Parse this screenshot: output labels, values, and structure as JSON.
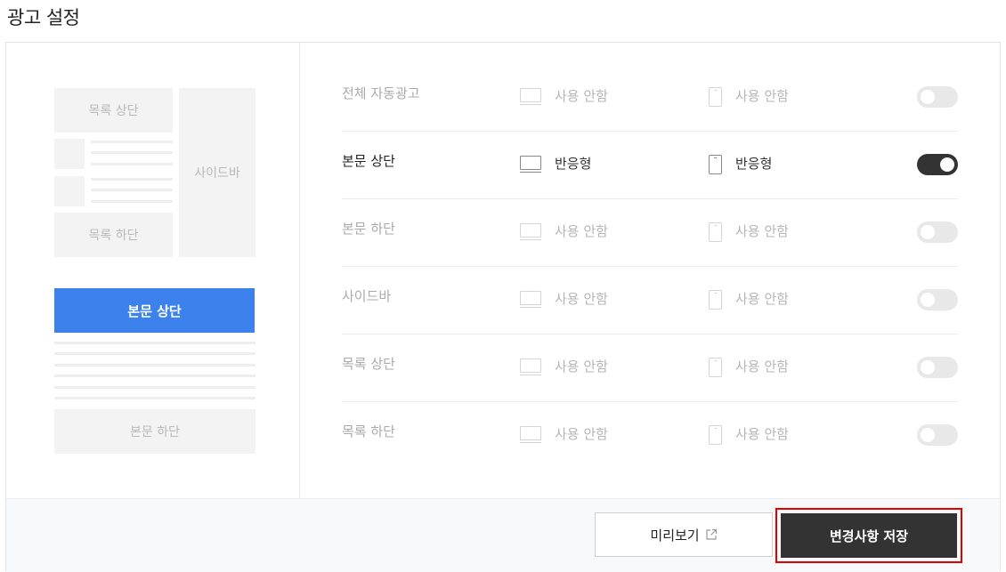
{
  "page": {
    "title": "광고 설정"
  },
  "preview": {
    "list_top": "목록 상단",
    "list_bottom": "목록 하단",
    "sidebar": "사이드바",
    "body_top": "본문 상단",
    "body_bottom": "본문 하단",
    "highlight_color": "#3d82ec"
  },
  "settings": {
    "rows": [
      {
        "label": "전체 자동광고",
        "pc": "사용 안함",
        "mobile": "사용 안함",
        "enabled": false
      },
      {
        "label": "본문 상단",
        "pc": "반응형",
        "mobile": "반응형",
        "enabled": true
      },
      {
        "label": "본문 하단",
        "pc": "사용 안함",
        "mobile": "사용 안함",
        "enabled": false
      },
      {
        "label": "사이드바",
        "pc": "사용 안함",
        "mobile": "사용 안함",
        "enabled": false
      },
      {
        "label": "목록 상단",
        "pc": "사용 안함",
        "mobile": "사용 안함",
        "enabled": false
      },
      {
        "label": "목록 하단",
        "pc": "사용 안함",
        "mobile": "사용 안함",
        "enabled": false
      }
    ]
  },
  "footer": {
    "preview_label": "미리보기",
    "preview_icon": "external-link-icon",
    "save_label": "변경사항 저장"
  },
  "colors": {
    "toggle_on": "#333333",
    "toggle_off": "#e8e8e8",
    "save_highlight": "#e00000"
  }
}
